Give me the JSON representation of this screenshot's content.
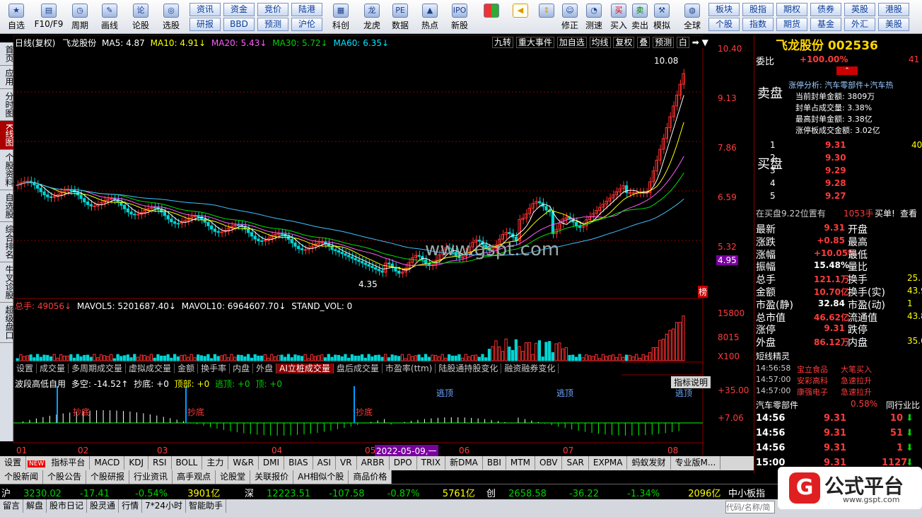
{
  "toolbar": {
    "items": [
      "自选",
      "F10/F9",
      "周期",
      "画线",
      "论股",
      "选股"
    ],
    "grid1": [
      [
        "资讯",
        "资金",
        "竞价",
        "陆港"
      ],
      [
        "研报",
        "BBD",
        "预测",
        "沪伦"
      ]
    ],
    "items2": [
      "科创",
      "龙虎",
      "数据",
      "热点",
      "新股"
    ],
    "items3": [
      "修正",
      "测速",
      "买入",
      "卖出",
      "模拟",
      "全球"
    ],
    "grid2": [
      [
        "板块",
        "股指",
        "期权",
        "债券",
        "英股",
        "港股"
      ],
      [
        "个股",
        "指数",
        "期货",
        "基金",
        "外汇",
        "美股"
      ]
    ]
  },
  "lefttabs": [
    "首页",
    "应用",
    "分时图",
    "K线图",
    "个股资料",
    "自选股",
    "综合排名",
    "牛叉诊股",
    "超级盘口"
  ],
  "kline": {
    "header": {
      "period": "日线(复权)",
      "name": "飞龙股份",
      "ma5": "MA5: 4.87",
      "ma10": "MA10: 4.91↓",
      "ma20": "MA20: 5.43↓",
      "ma30": "MA30: 5.72↓",
      "ma60": "MA60: 6.35↓"
    },
    "topbtns": [
      "九转",
      "重大事件",
      "加自选",
      "均线",
      "复权",
      "叠",
      "预测",
      "白"
    ],
    "prices": [
      "10.40",
      "9.13",
      "7.86",
      "6.59",
      "5.32"
    ],
    "cur_price": "4.95",
    "high_label": "10.08",
    "low_label": "4.35",
    "watermark": "www.gspt.com",
    "bang": "榜"
  },
  "volume": {
    "header": {
      "total": "总手: 49056↓",
      "mavol5": "MAVOL5: 5201687.40↓",
      "mavol10": "MAVOL10: 6964607.70↓",
      "stand": "STAND_VOL: 0"
    },
    "axis": [
      "15800",
      "8015",
      "X100"
    ]
  },
  "subtabs": [
    "设置",
    "成交量",
    "多周期成交量",
    "虚拟成交量",
    "金额",
    "换手率",
    "内盘",
    "外盘",
    "AI立桩成交量",
    "盘后成交量",
    "市盈率(ttm)",
    "陆股通持股变化",
    "融资融券变化"
  ],
  "wave": {
    "header": {
      "title": "波段高低自用",
      "kong": "多空: -14.52↑",
      "chaodi": "抄底: +0",
      "dingbu": "顶部: +0",
      "taoding": "逃顶: +0",
      "ding": "顶: +0"
    },
    "btn": "指标说明",
    "axis": [
      "+35.00",
      "+7.06"
    ],
    "marks": [
      "抄底",
      "抄底",
      "抄底",
      "逃顶",
      "逃顶",
      "逃顶"
    ]
  },
  "months": [
    "01",
    "02",
    "03",
    "04",
    "05",
    "06",
    "07",
    "08"
  ],
  "date_label": "2022-05-09,一",
  "indicator_tabs": [
    "设置",
    "指标平台",
    "MACD",
    "KDJ",
    "RSI",
    "BOLL",
    "主力",
    "W&R",
    "DMI",
    "BIAS",
    "ASI",
    "VR",
    "ARBR",
    "DPO",
    "TRIX",
    "新DMA",
    "BBI",
    "MTM",
    "OBV",
    "SAR",
    "EXPMA",
    "蚂蚁发财",
    "专业版M..."
  ],
  "new_badge": "NEW",
  "news_tabs": [
    "个股新闻",
    "个股公告",
    "个股研报",
    "行业资讯",
    "高手观点",
    "论股堂",
    "关联报价",
    "AH相似个股",
    "商品价格"
  ],
  "index_bar": [
    {
      "name": "沪",
      "price": "3230.02",
      "chg": "-17.41",
      "pct": "-0.54%",
      "amt": "3901亿"
    },
    {
      "name": "深",
      "price": "12223.51",
      "chg": "-107.58",
      "pct": "-0.87%",
      "amt": "5761亿"
    },
    {
      "name": "创",
      "price": "2658.58",
      "chg": "-36.22",
      "pct": "-1.34%",
      "amt": "2096亿"
    }
  ],
  "zxb": "中小板指",
  "status": [
    "留言",
    "解盘",
    "股市日记",
    "股灵通",
    "行情",
    "7*24小时",
    "智能助手"
  ],
  "search_placeholder": "代码/名称/简",
  "logo": {
    "text": "公式平台",
    "url": "www.gspt.com"
  },
  "right": {
    "stock": "飞龙股份 002536",
    "weibi_label": "委比",
    "weibi": "+100.00%",
    "weicha": "41",
    "analysis": "涨停分析: 汽车零部件+汽车热",
    "fengdan": "当前封单金额: 3809万",
    "fengdanzb": "封单占成交量: 3.38%",
    "zuigao": "最高封单金额: 3.38亿",
    "ztje": "涨停板成交金额: 3.02亿",
    "sell_label": "卖盘",
    "buy_label": "买盘",
    "bids": [
      {
        "lv": "1",
        "p": "9.31",
        "v": "40"
      },
      {
        "lv": "2",
        "p": "9.30",
        "v": ""
      },
      {
        "lv": "3",
        "p": "9.29",
        "v": ""
      },
      {
        "lv": "4",
        "p": "9.28",
        "v": ""
      },
      {
        "lv": "5",
        "p": "9.27",
        "v": ""
      }
    ],
    "zaimai": "在买盘9.22位置有",
    "zaimai_v": "1053手",
    "maidan": "买单!",
    "chakan": "查看",
    "quotes": [
      [
        "最新",
        "9.31",
        "开盘",
        ""
      ],
      [
        "涨跌",
        "+0.85",
        "最高",
        ""
      ],
      [
        "涨幅",
        "+10.05%",
        "最低",
        ""
      ],
      [
        "振幅",
        "15.48%",
        "量比",
        ""
      ],
      [
        "总手",
        "121.1万",
        "换手",
        "25."
      ],
      [
        "金额",
        "10.70亿",
        "换手(实)",
        "43.9"
      ],
      [
        "市盈(静)",
        "32.84",
        "市盈(动)",
        "1"
      ],
      [
        "总市值",
        "46.62亿",
        "流通值",
        "43.8"
      ],
      [
        "涨停",
        "9.31",
        "跌停",
        ""
      ],
      [
        "外盘",
        "86.12万",
        "内盘",
        "35.0"
      ]
    ],
    "short_title": "短线精灵",
    "short": [
      [
        "14:56:58",
        "宝立食品",
        "大笔买入"
      ],
      [
        "14:57:00",
        "安彩高科",
        "急速拉升"
      ],
      [
        "14:57:00",
        "康强电子",
        "急速拉升"
      ]
    ],
    "sector": "汽车零部件",
    "sector_pct": "0.58%",
    "sector_link": "同行业比",
    "ticks": [
      [
        "14:56",
        "9.31",
        "10"
      ],
      [
        "14:56",
        "9.31",
        "51"
      ],
      [
        "14:56",
        "9.31",
        "1"
      ],
      [
        "15:00",
        "9.31",
        "1127"
      ]
    ]
  }
}
